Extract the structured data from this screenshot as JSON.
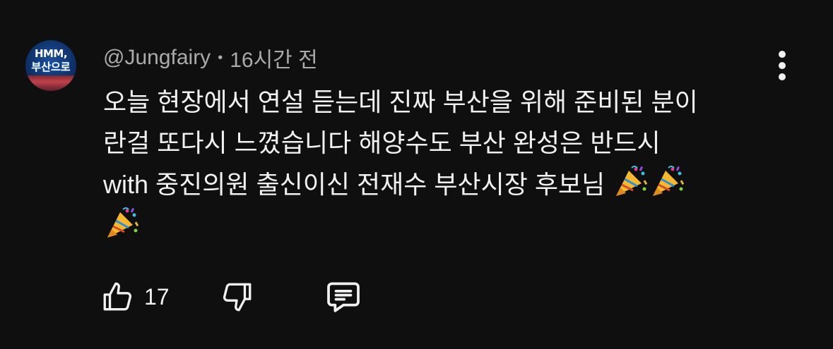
{
  "comment": {
    "avatar_text_top": "HMM,",
    "avatar_text_bottom": "부산으로",
    "author": "@Jungfairy",
    "separator": "•",
    "timestamp": "16시간 전",
    "lines": [
      "오늘 현장에서 연설 듣는데 진짜 부산을 위해 준비된 분이",
      "란걸 또다시 느꼈습니다 해양수도 부산 완성은 반드시",
      "with 중진의원 출신이신 전재수 부산시장 후보님"
    ],
    "emoji": "party-popper-emoji",
    "like_count": "17",
    "icons": {
      "like": "thumbs-up-icon",
      "dislike": "thumbs-down-icon",
      "reply": "comment-icon",
      "menu": "more-vert-icon"
    }
  }
}
